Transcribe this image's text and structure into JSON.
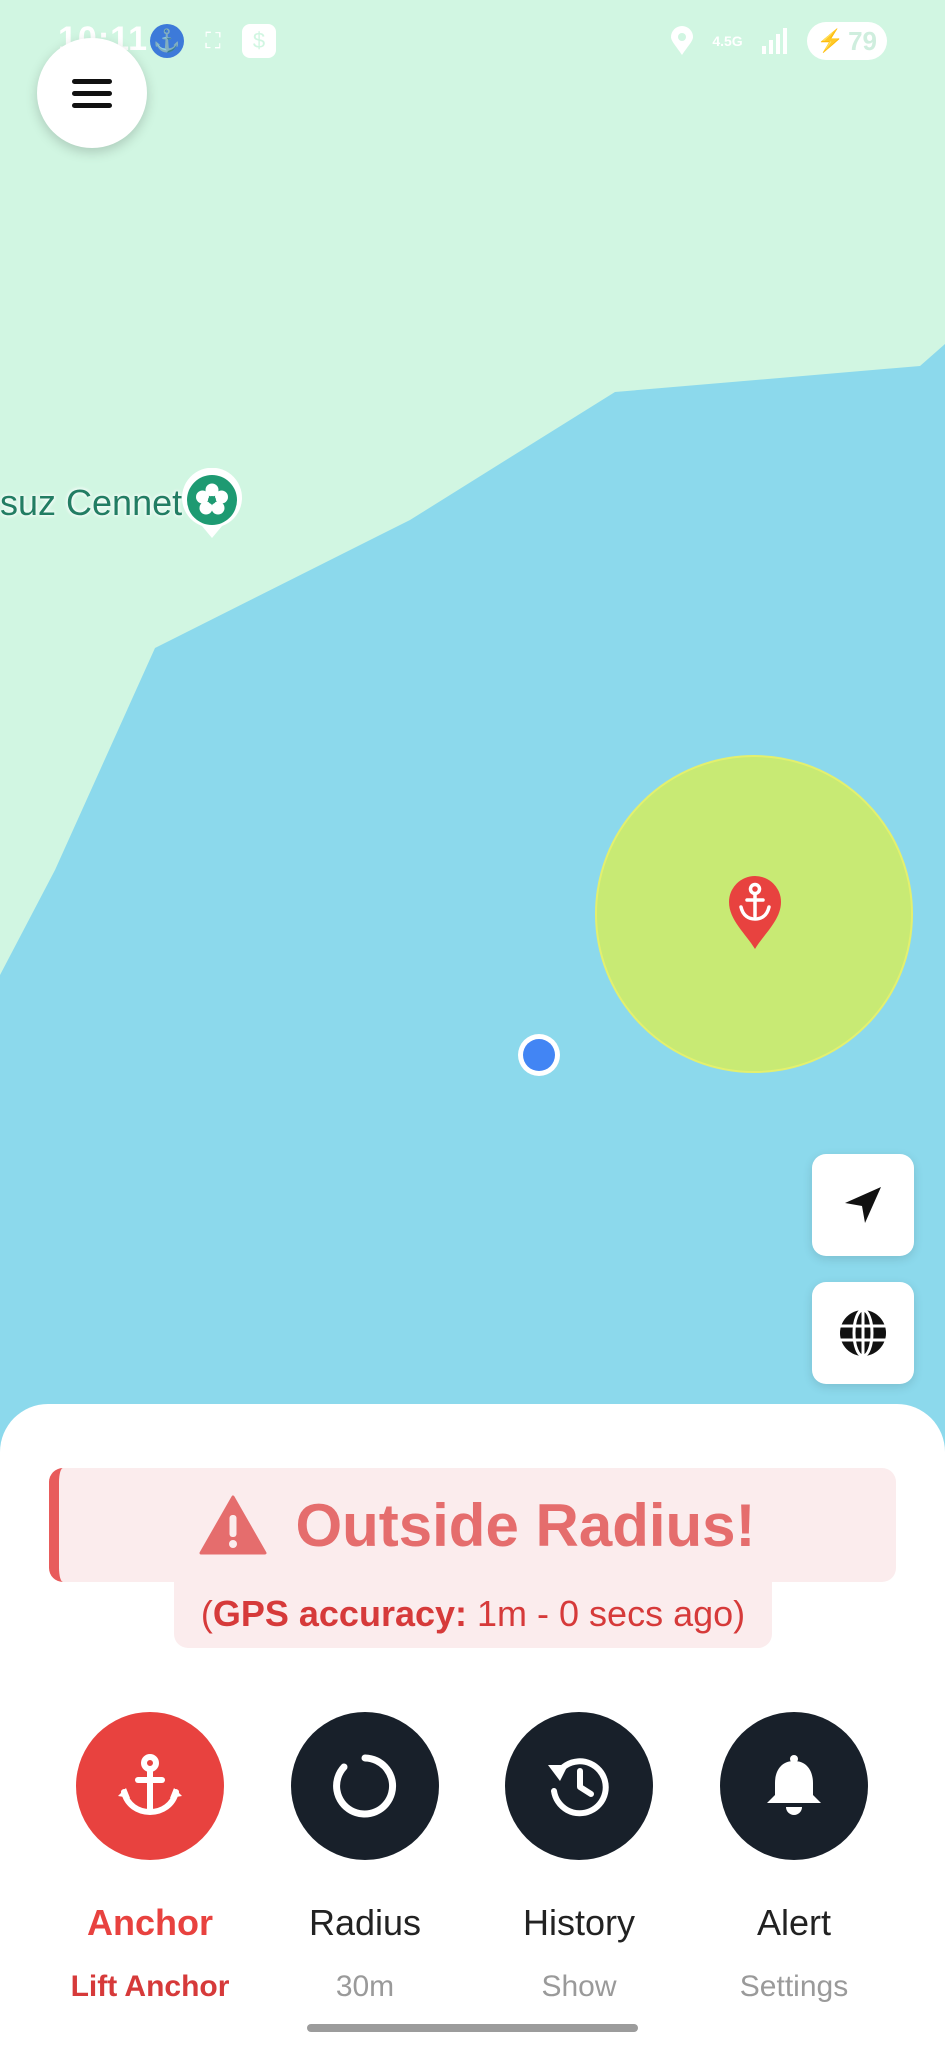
{
  "status_bar": {
    "time": "10:11",
    "network": "4.5G",
    "battery": "79"
  },
  "map": {
    "poi_label": "suz Cennet"
  },
  "alert": {
    "title": "Outside Radius!",
    "gps_label": "GPS accuracy:",
    "gps_value": "1m - 0 secs ago"
  },
  "actions": [
    {
      "label": "Anchor",
      "sub": "Lift Anchor",
      "icon": "anchor-icon"
    },
    {
      "label": "Radius",
      "sub": "30m",
      "icon": "radius-icon"
    },
    {
      "label": "History",
      "sub": "Show",
      "icon": "history-icon"
    },
    {
      "label": "Alert",
      "sub": "Settings",
      "icon": "bell-icon"
    }
  ],
  "colors": {
    "land": "#d1f6e2",
    "water": "#8cd9ec",
    "radius_fill": "#c8ea74",
    "accent_red": "#e8423f",
    "dark_button": "#18202a",
    "gps_dot": "#4285f4"
  }
}
